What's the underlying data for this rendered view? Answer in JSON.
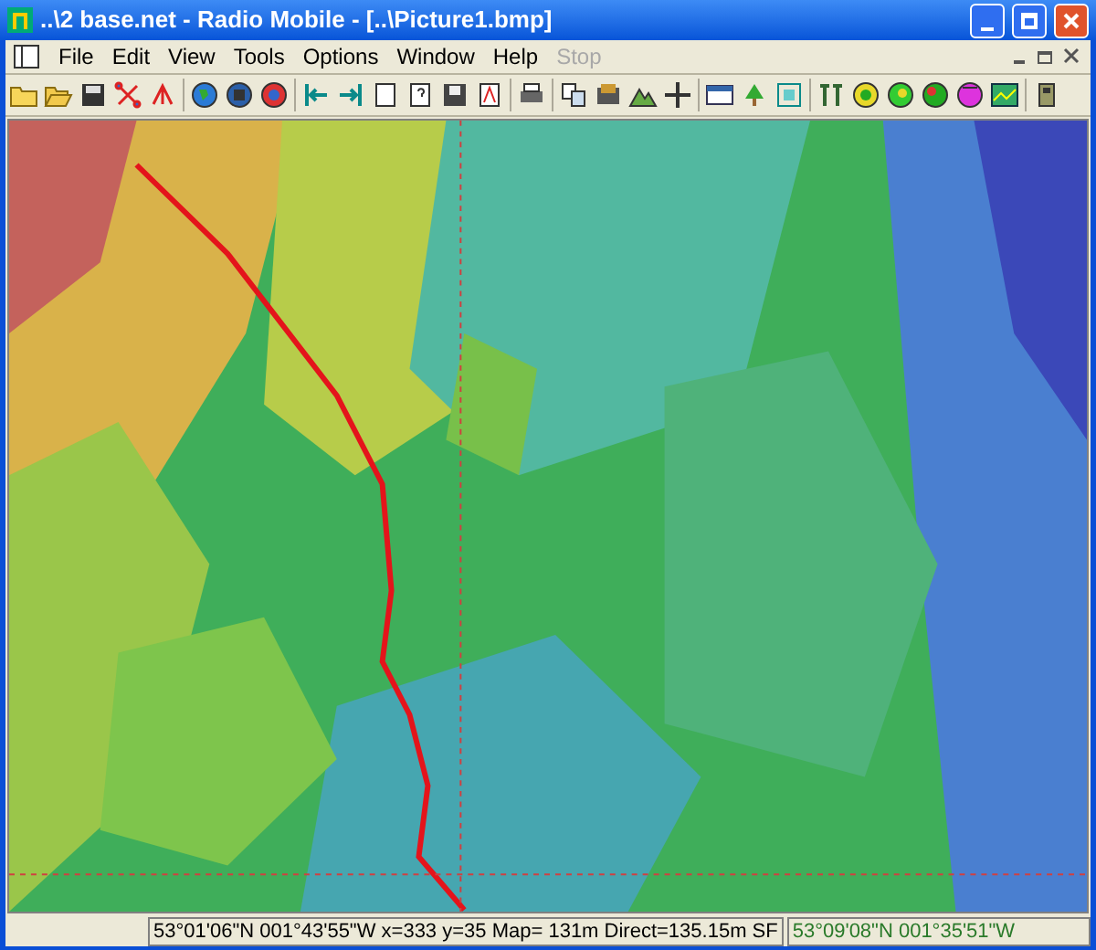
{
  "window": {
    "title": "..\\2 base.net - Radio Mobile - [..\\Picture1.bmp]"
  },
  "menu": [
    {
      "label": "File",
      "disabled": false
    },
    {
      "label": "Edit",
      "disabled": false
    },
    {
      "label": "View",
      "disabled": false
    },
    {
      "label": "Tools",
      "disabled": false
    },
    {
      "label": "Options",
      "disabled": false
    },
    {
      "label": "Window",
      "disabled": false
    },
    {
      "label": "Help",
      "disabled": false
    },
    {
      "label": "Stop",
      "disabled": true
    }
  ],
  "status_bar": {
    "cursor": "53°01'06\"N  001°43'55\"W  x=333 y=35 Map= 131m Direct=135.15m SF",
    "reference": "53°09'08\"N 001°35'51\"W"
  }
}
